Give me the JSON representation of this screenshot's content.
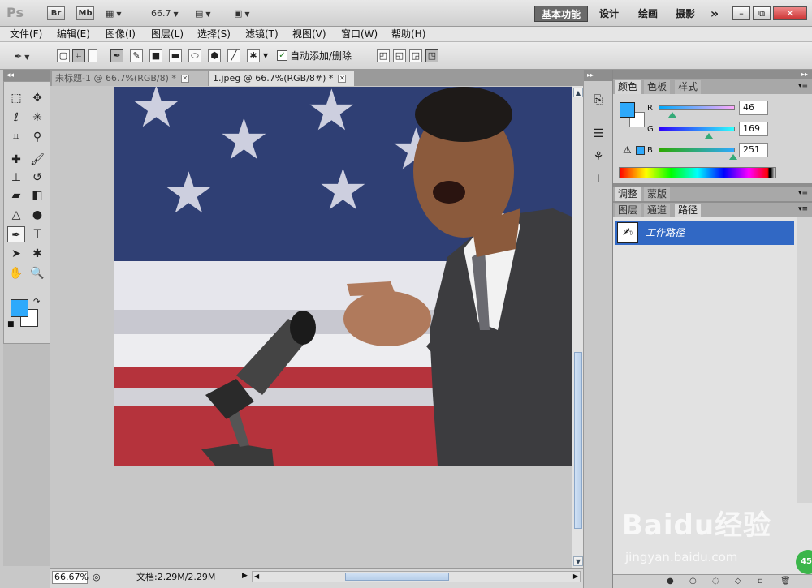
{
  "app": {
    "logo": "Ps",
    "bridge_label": "Br",
    "minibridge_label": "Mb",
    "zoom_select": "66.7",
    "workspaces": [
      "基本功能",
      "设计",
      "绘画",
      "摄影"
    ],
    "more_label": "»",
    "window_buttons": [
      "–",
      "⧉",
      "✕"
    ]
  },
  "menu": [
    "文件(F)",
    "编辑(E)",
    "图像(I)",
    "图层(L)",
    "选择(S)",
    "滤镜(T)",
    "视图(V)",
    "窗口(W)",
    "帮助(H)"
  ],
  "options": {
    "auto_add_delete_label": "自动添加/删除",
    "auto_add_delete_checked": "✓"
  },
  "tabs": [
    {
      "label": "未标题-1 @ 66.7%(RGB/8) *",
      "active": false
    },
    {
      "label": "1.jpeg @ 66.7%(RGB/8#) *",
      "active": true
    }
  ],
  "status": {
    "zoom": "66.67%",
    "doc_info": "文档:2.29M/2.29M"
  },
  "color_panel": {
    "tabs": [
      "颜色",
      "色板",
      "样式"
    ],
    "r_label": "R",
    "g_label": "G",
    "b_label": "B",
    "r": "46",
    "g": "169",
    "b": "251",
    "r_fraction": 0.18,
    "g_fraction": 0.66,
    "b_fraction": 0.98,
    "foreground": "#2ea9fb",
    "background": "#ffffff"
  },
  "adjust_panel": {
    "tabs": [
      "调整",
      "蒙版"
    ]
  },
  "layers_panel": {
    "tabs": [
      "图层",
      "通道",
      "路径"
    ],
    "paths": [
      {
        "label": "工作路径"
      }
    ]
  },
  "watermark": {
    "main": "Baidu经验",
    "sub": "jingyan.baidu.com",
    "badge": "45"
  },
  "colors": {
    "accent_selection": "#3168c4",
    "flag_blue": "#2f3f74",
    "flag_red": "#b5333c"
  }
}
